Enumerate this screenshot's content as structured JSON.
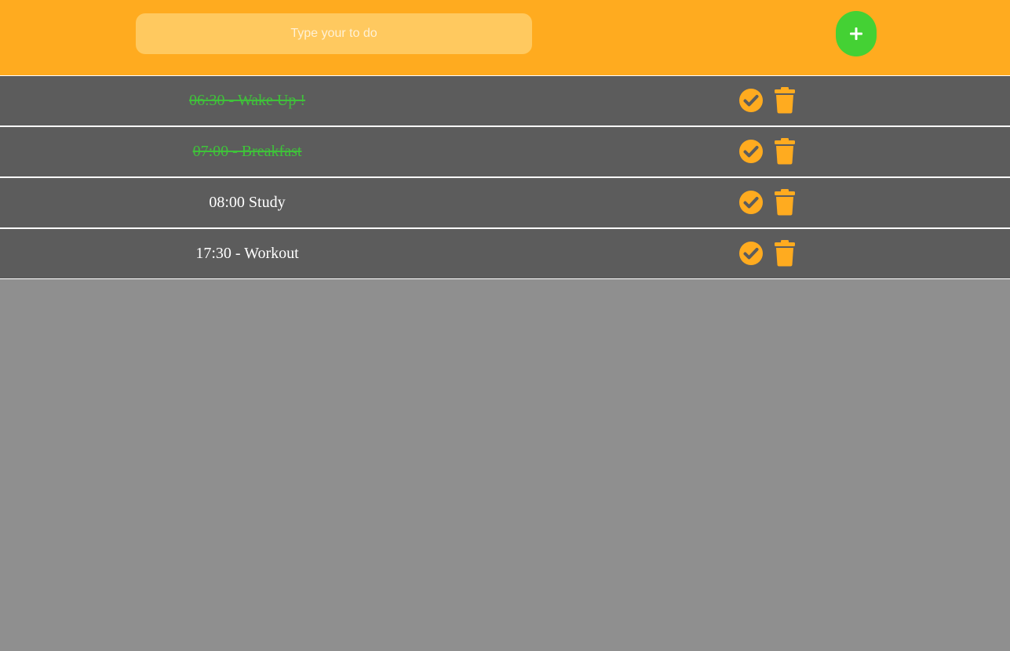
{
  "header": {
    "input_placeholder": "Type your to do",
    "input_value": "",
    "add_icon": "plus-icon"
  },
  "colors": {
    "header_bg": "#ffab1f",
    "input_bg": "#ffc95f",
    "add_button": "#44d134",
    "row_bg": "#5c5c5c",
    "page_bg": "#8f8f8f",
    "completed_text": "#3fc23a",
    "icon_accent": "#ffab1f"
  },
  "todos": [
    {
      "text": "06:30 - Wake Up !",
      "completed": true
    },
    {
      "text": "07:00 - Breakfast",
      "completed": true
    },
    {
      "text": "08:00 Study",
      "completed": false
    },
    {
      "text": "17:30 - Workout",
      "completed": false
    }
  ],
  "row_icons": {
    "complete": "check-circle-icon",
    "delete": "trash-icon"
  }
}
